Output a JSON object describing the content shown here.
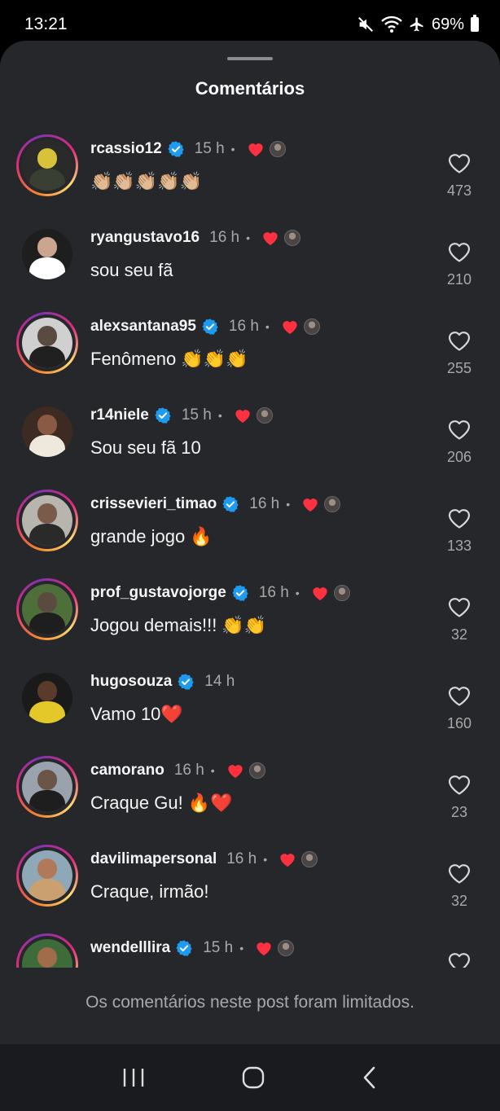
{
  "status_bar": {
    "time": "13:21",
    "battery": "69%"
  },
  "sheet": {
    "title": "Comentários"
  },
  "comments": [
    {
      "username": "rcassio12",
      "verified": true,
      "time": "15 h",
      "dot": "•",
      "creator_liked": true,
      "text": "👏🏼👏🏼👏🏼👏🏼👏🏼",
      "likes": "473",
      "ring": true,
      "avatar_colors": [
        "#2a2a2a",
        "#d8c23a",
        "#3a3f33"
      ]
    },
    {
      "username": "ryangustavo16",
      "verified": false,
      "time": "16 h",
      "dot": "•",
      "creator_liked": true,
      "text": "sou seu fã",
      "likes": "210",
      "ring": false,
      "avatar_colors": [
        "#1e1e1e",
        "#caa590",
        "#ffffff"
      ]
    },
    {
      "username": "alexsantana95",
      "verified": true,
      "time": "16 h",
      "dot": "•",
      "creator_liked": true,
      "text": "Fenômeno 👏👏👏",
      "likes": "255",
      "ring": true,
      "avatar_colors": [
        "#cfd0cf",
        "#5a4a40",
        "#202020"
      ]
    },
    {
      "username": "r14niele",
      "verified": true,
      "time": "15 h",
      "dot": "•",
      "creator_liked": true,
      "text": "Sou seu fã 10",
      "likes": "206",
      "ring": false,
      "avatar_colors": [
        "#3d2a22",
        "#8a5a44",
        "#efe8dc"
      ]
    },
    {
      "username": "crissevieri_timao",
      "verified": true,
      "time": "16 h",
      "dot": "•",
      "creator_liked": true,
      "text": "grande jogo 🔥",
      "likes": "133",
      "ring": true,
      "avatar_colors": [
        "#b8b4ae",
        "#7a5a48",
        "#2a2a2a"
      ]
    },
    {
      "username": "prof_gustavojorge",
      "verified": true,
      "time": "16 h",
      "dot": "•",
      "creator_liked": true,
      "text": "Jogou demais!!! 👏👏",
      "likes": "32",
      "ring": true,
      "avatar_colors": [
        "#4f6f3a",
        "#5a4a40",
        "#1e1e1e"
      ]
    },
    {
      "username": "hugosouza",
      "verified": true,
      "time": "14 h",
      "dot": "",
      "creator_liked": false,
      "text": "Vamo 10❤️",
      "likes": "160",
      "ring": false,
      "avatar_colors": [
        "#1a1a1a",
        "#5a3a2a",
        "#e4c82a"
      ]
    },
    {
      "username": "camorano",
      "verified": false,
      "time": "16 h",
      "dot": "•",
      "creator_liked": true,
      "text": "Craque Gu! 🔥❤️",
      "likes": "23",
      "ring": true,
      "avatar_colors": [
        "#9aa3ad",
        "#6a5548",
        "#1e1e1e"
      ]
    },
    {
      "username": "davilimapersonal",
      "verified": false,
      "time": "16 h",
      "dot": "•",
      "creator_liked": true,
      "text": "Craque, irmão!",
      "likes": "32",
      "ring": true,
      "avatar_colors": [
        "#8fa8b8",
        "#b07a5a",
        "#caa070"
      ]
    },
    {
      "username": "wendelllira",
      "verified": true,
      "time": "15 h",
      "dot": "•",
      "creator_liked": true,
      "text": "",
      "likes": "",
      "ring": true,
      "avatar_colors": [
        "#3d6b3a",
        "#a06c4a",
        "#e8e8e8"
      ]
    }
  ],
  "footer": {
    "note": "Os comentários neste post foram limitados."
  },
  "colors": {
    "sheet_bg": "#25272b",
    "verified_blue": "#1d9bf0",
    "heart_red": "#ff3040",
    "muted_text": "#a8a8a8"
  },
  "icons": {
    "status": [
      "mute-icon",
      "wifi-icon",
      "airplane-icon",
      "battery-icon"
    ],
    "nav": [
      "recent-apps-icon",
      "home-icon",
      "back-icon"
    ]
  }
}
